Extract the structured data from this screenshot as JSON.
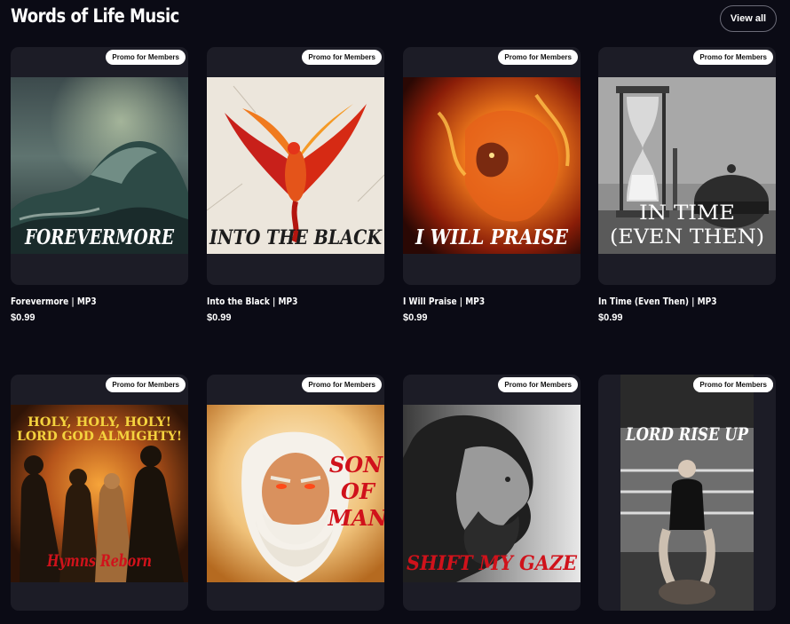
{
  "header": {
    "title": "Words of Life Music",
    "view_all_label": "View all"
  },
  "badge_label": "Promo for Members",
  "products": [
    {
      "title": "Forevermore | MP3",
      "price": "$0.99",
      "art_text": "FOREVERMORE",
      "art_icon": "ocean-wave-image"
    },
    {
      "title": "Into the Black | MP3",
      "price": "$0.99",
      "art_text": "INTO THE BLACK",
      "art_icon": "phoenix-image"
    },
    {
      "title": "I Will Praise | MP3",
      "price": "$0.99",
      "art_text": "I WILL PRAISE",
      "art_icon": "fire-lion-image"
    },
    {
      "title": "In Time (Even Then) | MP3",
      "price": "$0.99",
      "art_text_line1": "IN TIME",
      "art_text_line2": "(EVEN THEN)",
      "art_icon": "hourglass-image"
    },
    {
      "art_text_line1": "HOLY, HOLY, HOLY!",
      "art_text_line2": "LORD GOD ALMIGHTY!",
      "art_text_bottom": "Hymns Reborn",
      "art_icon": "fire-figures-image"
    },
    {
      "art_text_line1": "SON",
      "art_text_line2": "OF",
      "art_text_line3": "MAN",
      "art_icon": "old-man-portrait-image"
    },
    {
      "art_text": "SHIFT MY GAZE",
      "art_icon": "bearded-man-profile-image"
    },
    {
      "art_text": "LORD RISE UP",
      "art_icon": "boxing-ring-woman-image"
    }
  ],
  "colors": {
    "background": "#0b0b15",
    "card": "#1c1c26",
    "badge_bg": "#ffffff",
    "art_red": "#d0121b"
  }
}
